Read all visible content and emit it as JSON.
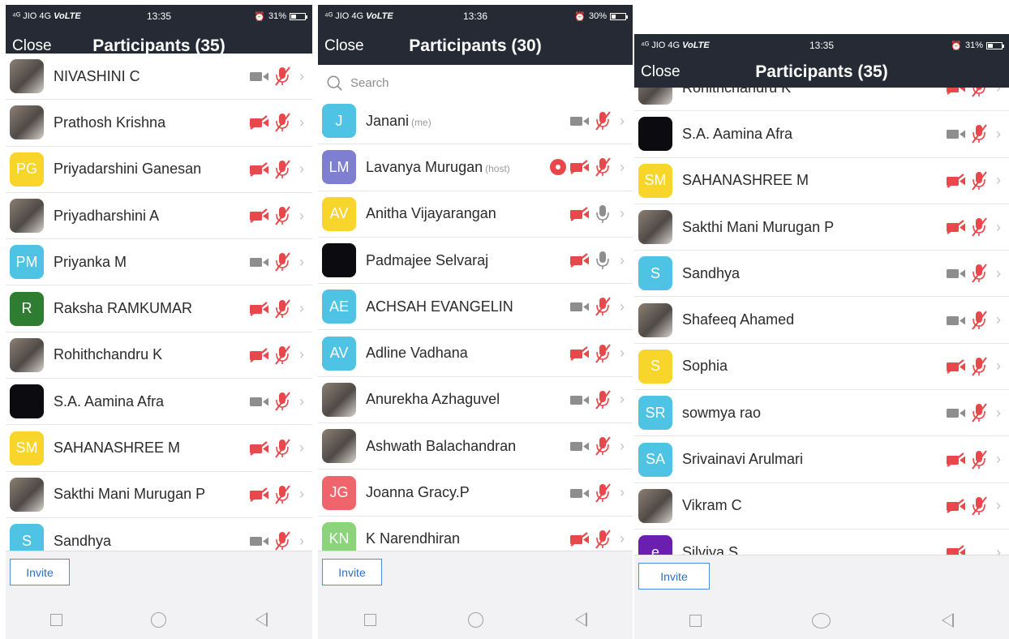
{
  "panels": [
    {
      "status": {
        "carrier": "JIO 4G",
        "volte": "VoLTE",
        "time": "13:35",
        "battery": "31%",
        "battery_level": 0.31
      },
      "close_label": "Close",
      "title": "Participants (35)",
      "invite_label": "Invite",
      "participants": [
        {
          "name": "NIVASHINI C",
          "avatar_type": "photo",
          "video": "on",
          "mic": "muted"
        },
        {
          "name": "Prathosh Krishna",
          "avatar_type": "photo",
          "video": "off",
          "mic": "muted"
        },
        {
          "name": "Priyadarshini Ganesan",
          "avatar_type": "initials",
          "initials": "PG",
          "color": "#f7d52a",
          "video": "off",
          "mic": "muted"
        },
        {
          "name": "Priyadharshini A",
          "avatar_type": "photo",
          "video": "off",
          "mic": "muted"
        },
        {
          "name": "Priyanka M",
          "avatar_type": "initials",
          "initials": "PM",
          "color": "#4fc3e3",
          "video": "on",
          "mic": "muted"
        },
        {
          "name": "Raksha RAMKUMAR",
          "avatar_type": "initials",
          "initials": "R",
          "color": "#2e7d32",
          "video": "off",
          "mic": "muted"
        },
        {
          "name": "Rohithchandru K",
          "avatar_type": "photo",
          "video": "off",
          "mic": "muted"
        },
        {
          "name": "S.A. Aamina Afra",
          "avatar_type": "dark",
          "video": "on",
          "mic": "muted"
        },
        {
          "name": "SAHANASHREE M",
          "avatar_type": "initials",
          "initials": "SM",
          "color": "#f7d52a",
          "video": "off",
          "mic": "muted"
        },
        {
          "name": "Sakthi Mani Murugan P",
          "avatar_type": "photo",
          "video": "off",
          "mic": "muted"
        },
        {
          "name": "Sandhya",
          "avatar_type": "initials",
          "initials": "S",
          "color": "#4fc3e3",
          "video": "on",
          "mic": "muted"
        }
      ]
    },
    {
      "status": {
        "carrier": "JIO 4G",
        "volte": "VoLTE",
        "time": "13:36",
        "battery": "30%",
        "battery_level": 0.3
      },
      "close_label": "Close",
      "title": "Participants (30)",
      "search_placeholder": "Search",
      "invite_label": "Invite",
      "participants": [
        {
          "name": "Janani",
          "tag": "(me)",
          "avatar_type": "initials",
          "initials": "J",
          "color": "#4fc3e3",
          "video": "on",
          "mic": "muted"
        },
        {
          "name": "Lavanya Murugan",
          "tag": "(host)",
          "avatar_type": "initials",
          "initials": "LM",
          "color": "#7e7fd0",
          "video": "off",
          "mic": "muted",
          "recording": true
        },
        {
          "name": "Anitha Vijayarangan",
          "avatar_type": "initials",
          "initials": "AV",
          "color": "#f7d52a",
          "video": "off",
          "mic": "on"
        },
        {
          "name": "Padmajee Selvaraj",
          "avatar_type": "dark",
          "video": "off",
          "mic": "on"
        },
        {
          "name": "ACHSAH EVANGELIN",
          "avatar_type": "initials",
          "initials": "AE",
          "color": "#4fc3e3",
          "video": "on",
          "mic": "muted"
        },
        {
          "name": "Adline Vadhana",
          "avatar_type": "initials",
          "initials": "AV",
          "color": "#4fc3e3",
          "video": "off",
          "mic": "muted"
        },
        {
          "name": "Anurekha Azhaguvel",
          "avatar_type": "photo",
          "video": "on",
          "mic": "muted"
        },
        {
          "name": "Ashwath Balachandran",
          "avatar_type": "photo",
          "video": "on",
          "mic": "muted"
        },
        {
          "name": "Joanna Gracy.P",
          "avatar_type": "initials",
          "initials": "JG",
          "color": "#f0646b",
          "video": "on",
          "mic": "muted"
        },
        {
          "name": "K Narendhiran",
          "avatar_type": "initials",
          "initials": "KN",
          "color": "#8bd47c",
          "video": "off",
          "mic": "muted"
        }
      ]
    },
    {
      "status": {
        "carrier": "JIO 4G",
        "volte": "VoLTE",
        "time": "13:35",
        "battery": "31%",
        "battery_level": 0.31
      },
      "close_label": "Close",
      "title": "Participants (35)",
      "invite_label": "Invite",
      "participants": [
        {
          "name": "Rohithchandru K",
          "avatar_type": "photo",
          "video": "off",
          "mic": "muted"
        },
        {
          "name": "S.A. Aamina Afra",
          "avatar_type": "dark",
          "video": "on",
          "mic": "muted"
        },
        {
          "name": "SAHANASHREE M",
          "avatar_type": "initials",
          "initials": "SM",
          "color": "#f7d52a",
          "video": "off",
          "mic": "muted"
        },
        {
          "name": "Sakthi Mani Murugan P",
          "avatar_type": "photo",
          "video": "off",
          "mic": "muted"
        },
        {
          "name": "Sandhya",
          "avatar_type": "initials",
          "initials": "S",
          "color": "#4fc3e3",
          "video": "on",
          "mic": "muted"
        },
        {
          "name": "Shafeeq Ahamed",
          "avatar_type": "photo",
          "video": "on",
          "mic": "muted"
        },
        {
          "name": "Sophia",
          "avatar_type": "initials",
          "initials": "S",
          "color": "#f7d52a",
          "video": "off",
          "mic": "muted"
        },
        {
          "name": "sowmya rao",
          "avatar_type": "initials",
          "initials": "SR",
          "color": "#4fc3e3",
          "video": "on",
          "mic": "muted"
        },
        {
          "name": "Srivainavi Arulmari",
          "avatar_type": "initials",
          "initials": "SA",
          "color": "#4fc3e3",
          "video": "off",
          "mic": "muted"
        },
        {
          "name": "Vikram C",
          "avatar_type": "photo",
          "video": "off",
          "mic": "muted"
        },
        {
          "name": "Silviya S",
          "avatar_type": "initials",
          "initials": "e",
          "color": "#6a1fb0",
          "video": "off",
          "mic": "none"
        }
      ]
    }
  ],
  "colors": {
    "header": "#262a35",
    "muted_red": "#e8484b",
    "active_gray": "#8e8e8e",
    "invite_blue": "#4a90e2"
  },
  "icons": {
    "video_on": "video-camera-icon",
    "video_off": "video-camera-off-icon",
    "mic_on": "microphone-icon",
    "mic_muted": "microphone-muted-icon",
    "recording": "recording-dot-icon",
    "chevron": "chevron-right-icon",
    "search": "search-icon"
  }
}
